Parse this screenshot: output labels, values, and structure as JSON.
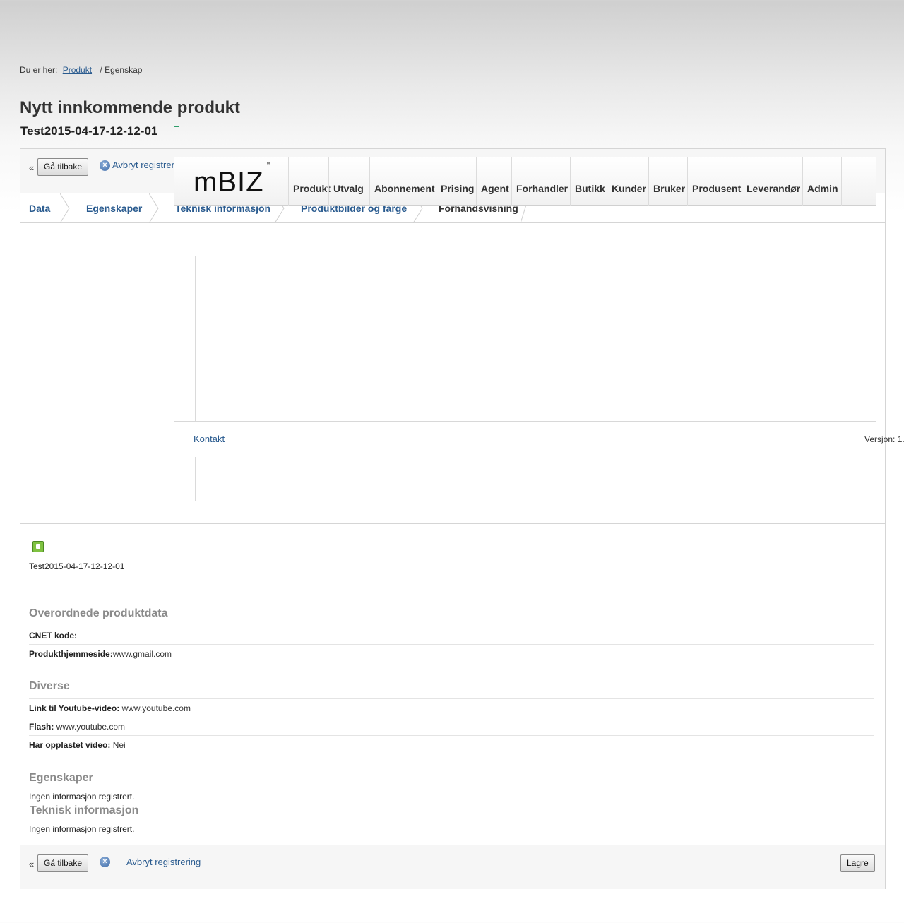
{
  "breadcrumb": {
    "prefix": "Du er her:",
    "link": "Produkt",
    "current": "/ Egenskap"
  },
  "page": {
    "title": "Nytt innkommende produkt",
    "subtitle": "Test2015-04-17-12-12-01"
  },
  "toolbar": {
    "back_arrow": "«",
    "back_label": "Gå tilbake",
    "cancel_label": "Avbryt registrer"
  },
  "tabs": [
    "Data",
    "Egenskaper",
    "Teknisk informasjon",
    "Produktbilder og farge",
    "Forhåndsvisning"
  ],
  "header": {
    "logo": "mBIZ",
    "logo_tm": "™",
    "nav": [
      "Produkt",
      "Utvalg",
      "Abonnement",
      "Prising",
      "Agent",
      "Forhandler",
      "Butikk",
      "Kunder",
      "Bruker",
      "Produsent",
      "Leverandør",
      "Admin"
    ]
  },
  "footer_links": {
    "contact": "Kontakt",
    "version": "Versjon: 1."
  },
  "preview": {
    "product_name": "Test2015-04-17-12-12-01",
    "sections": {
      "overordnede": {
        "title": "Overordnede produktdata",
        "cnet_label": "CNET kode:",
        "cnet_value": "",
        "homepage_label": "Produkthjemmeside:",
        "homepage_value": "www.gmail.com"
      },
      "diverse": {
        "title": "Diverse",
        "youtube_label": "Link til Youtube-video:",
        "youtube_value": " www.youtube.com",
        "flash_label": "Flash:",
        "flash_value": " www.youtube.com",
        "uploaded_label": "Har opplastet video:",
        "uploaded_value": " Nei"
      },
      "egenskaper": {
        "title": "Egenskaper",
        "empty": "Ingen informasjon registrert."
      },
      "teknisk": {
        "title": "Teknisk informasjon",
        "empty": "Ingen informasjon registrert."
      }
    }
  },
  "bottom_toolbar": {
    "back_arrow": "«",
    "back_label": "Gå tilbake",
    "cancel_label": "Avbryt registrering",
    "save_label": "Lagre"
  },
  "colors": {
    "link": "#2a5b8f",
    "section_heading": "#8a8a8a",
    "accent_green": "#7fc241"
  }
}
